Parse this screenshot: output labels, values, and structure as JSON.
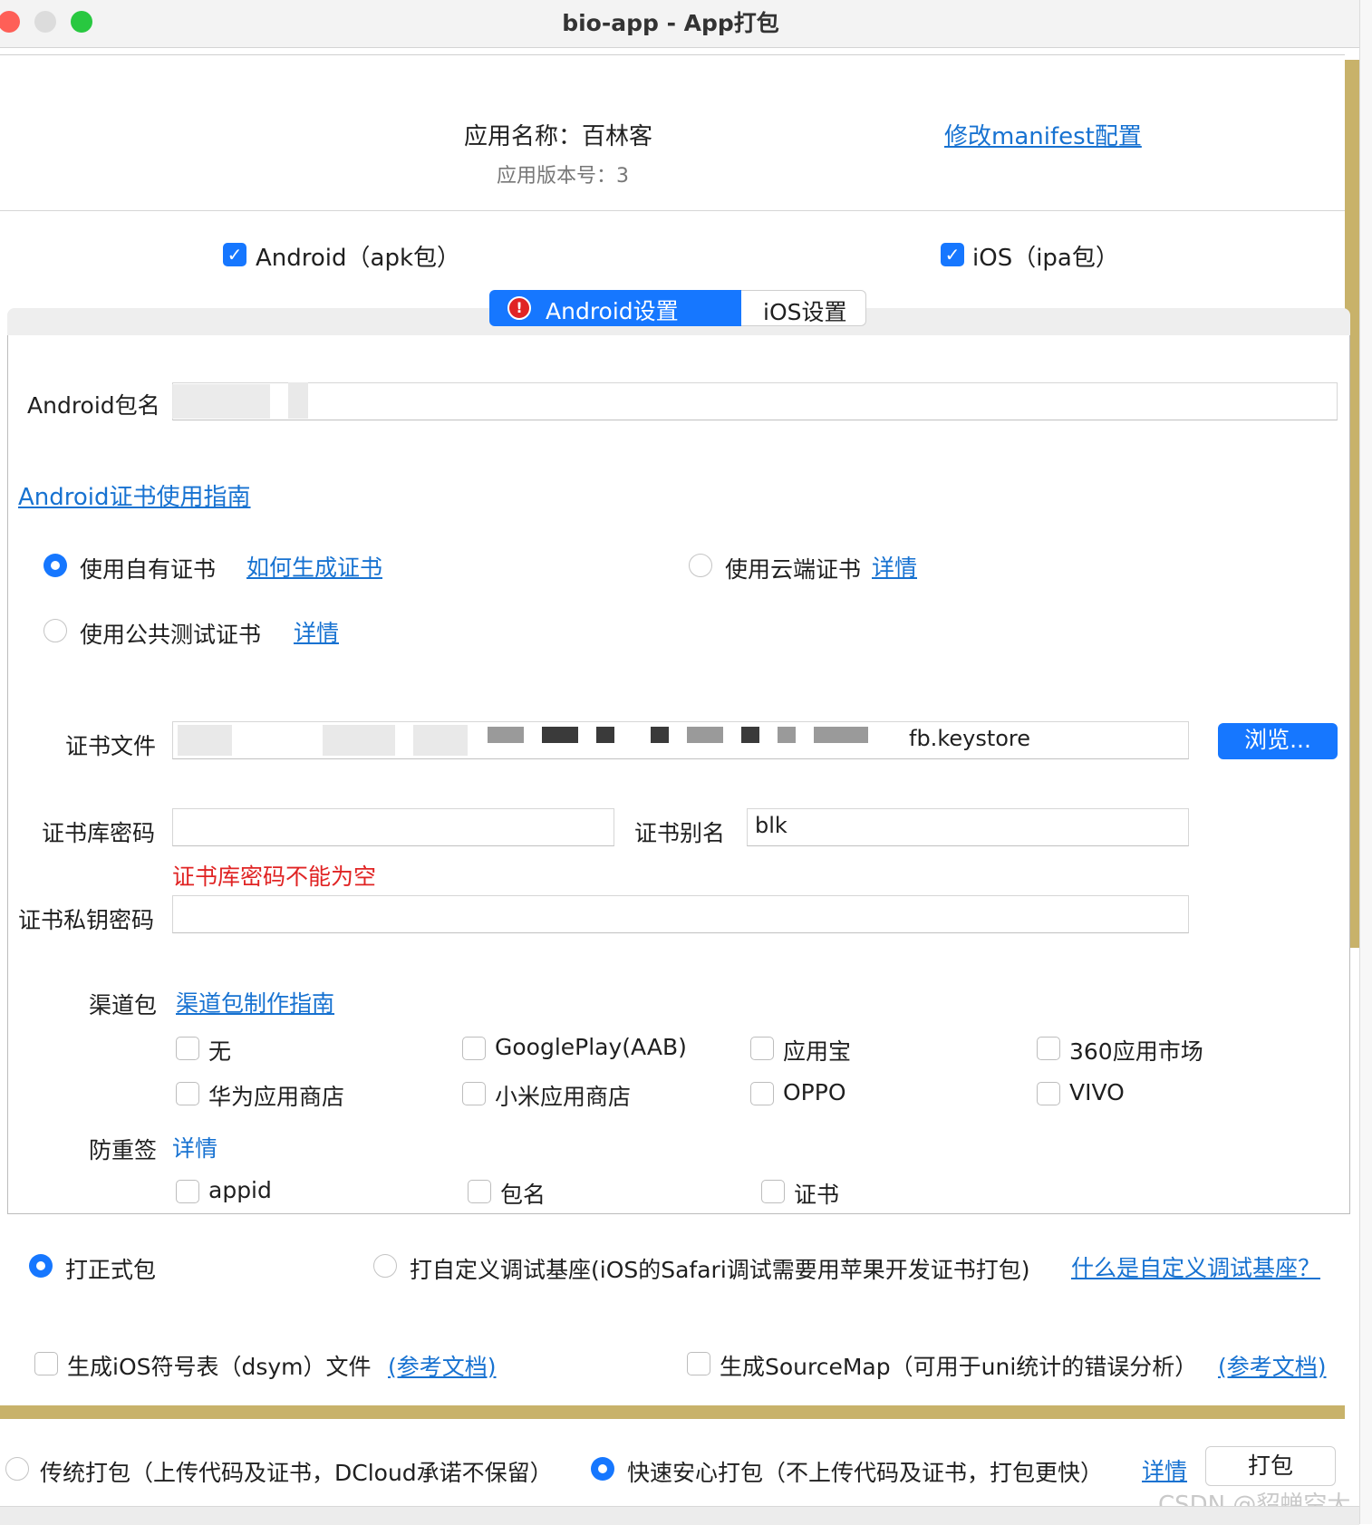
{
  "window": {
    "title": "bio-app - App打包"
  },
  "app_info": {
    "name_label": "应用名称：百林客",
    "version_label": "应用版本号：3",
    "manifest_link": "修改manifest配置"
  },
  "platforms": {
    "android": {
      "label": "Android（apk包）",
      "checked": true
    },
    "ios": {
      "label": "iOS（ipa包）",
      "checked": true
    }
  },
  "tabs": [
    {
      "label": "Android设置",
      "active": true,
      "has_error": true
    },
    {
      "label": "iOS设置",
      "active": false
    }
  ],
  "android": {
    "package_name_label": "Android包名",
    "cert_guide_link": "Android证书使用指南",
    "cert_options": {
      "own": {
        "label": "使用自有证书",
        "link": "如何生成证书",
        "selected": true
      },
      "cloud": {
        "label": "使用云端证书",
        "link": "详情",
        "selected": false
      },
      "public_test": {
        "label": "使用公共测试证书",
        "link": "详情",
        "selected": false
      }
    },
    "cert_file_label": "证书文件",
    "cert_file_value": "fb.keystore",
    "browse_button": "浏览...",
    "keystore_password_label": "证书库密码",
    "keystore_password_value": "",
    "alias_label": "证书别名",
    "alias_value": "blk",
    "password_error": "证书库密码不能为空",
    "private_key_password_label": "证书私钥密码",
    "private_key_password_value": "",
    "channel_label": "渠道包",
    "channel_guide_link": "渠道包制作指南",
    "channels": [
      {
        "label": "无",
        "checked": false
      },
      {
        "label": "GooglePlay(AAB)",
        "checked": false
      },
      {
        "label": "应用宝",
        "checked": false
      },
      {
        "label": "360应用市场",
        "checked": false
      },
      {
        "label": "华为应用商店",
        "checked": false
      },
      {
        "label": "小米应用商店",
        "checked": false
      },
      {
        "label": "OPPO",
        "checked": false
      },
      {
        "label": "VIVO",
        "checked": false
      }
    ],
    "anti_resign_label": "防重签",
    "anti_resign_link": "详情",
    "anti_resign_options": [
      {
        "label": "appid",
        "checked": false
      },
      {
        "label": "包名",
        "checked": false
      },
      {
        "label": "证书",
        "checked": false
      }
    ]
  },
  "build_type": {
    "release": {
      "label": "打正式包",
      "selected": true
    },
    "custom_base": {
      "label": "打自定义调试基座(iOS的Safari调试需要用苹果开发证书打包)",
      "selected": false
    },
    "custom_base_link": "什么是自定义调试基座？"
  },
  "extras": {
    "dsym": {
      "label": "生成iOS符号表（dsym）文件",
      "link": "(参考文档)",
      "checked": false
    },
    "sourcemap": {
      "label": "生成SourceMap（可用于uni统计的错误分析）",
      "link": "(参考文档)",
      "checked": false
    }
  },
  "pack_mode": {
    "traditional": {
      "label": "传统打包（上传代码及证书，DCloud承诺不保留）",
      "selected": false
    },
    "fast": {
      "label": "快速安心打包（不上传代码及证书，打包更快）",
      "selected": true
    },
    "details_link": "详情",
    "pack_button": "打包"
  },
  "watermark": "CSDN @貂蝉空大",
  "colors": {
    "accent": "#1677ff",
    "link": "#1772d1",
    "error": "#e02424",
    "side_bar": "#c8b26a"
  }
}
